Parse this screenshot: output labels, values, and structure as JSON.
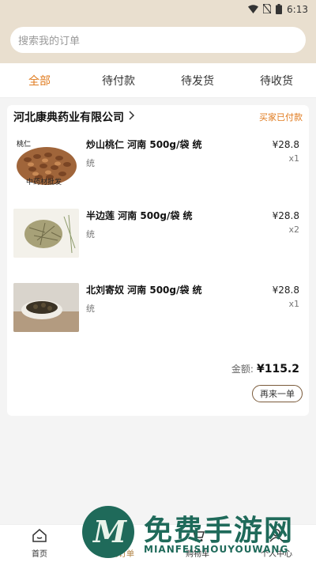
{
  "status_bar": {
    "time": "6:13",
    "icons": [
      "wifi-icon",
      "no-sim-icon",
      "battery-icon"
    ]
  },
  "search": {
    "placeholder": "搜索我的订单"
  },
  "tabs": [
    {
      "label": "全部",
      "active": true
    },
    {
      "label": "待付款",
      "active": false
    },
    {
      "label": "待发货",
      "active": false
    },
    {
      "label": "待收货",
      "active": false
    }
  ],
  "order": {
    "store_name": "河北康典药业有限公司",
    "status": "买家已付款",
    "items": [
      {
        "thumb_label": "桃仁",
        "thumb_caption": "中药材批发",
        "name": "炒山桃仁 河南 500g/袋 统",
        "spec": "统",
        "price": "¥28.8",
        "qty": "x1"
      },
      {
        "thumb_label": "",
        "thumb_caption": "",
        "name": "半边莲 河南 500g/袋 统",
        "spec": "统",
        "price": "¥28.8",
        "qty": "x2"
      },
      {
        "thumb_label": "",
        "thumb_caption": "",
        "name": "北刘寄奴 河南 500g/袋 统",
        "spec": "统",
        "price": "¥28.8",
        "qty": "x1"
      }
    ],
    "total_label": "金额:",
    "total_amount": "¥115.2",
    "rebuy_label": "再来一单"
  },
  "bottom_nav": [
    {
      "label": "首页",
      "icon": "home-icon",
      "active": false
    },
    {
      "label": "我的订单",
      "icon": "order-icon",
      "active": true
    },
    {
      "label": "购物车",
      "icon": "cart-icon",
      "active": false
    },
    {
      "label": "个人中心",
      "icon": "user-icon",
      "active": false
    }
  ],
  "watermark": {
    "title": "免费手游网",
    "subtitle": "MIANFEISHOUYOUWANG"
  },
  "colors": {
    "header_bg": "#e9dfcf",
    "accent": "#e07b1f",
    "brand_brown": "#7a5a3a",
    "watermark_green": "#1f6a5a"
  }
}
